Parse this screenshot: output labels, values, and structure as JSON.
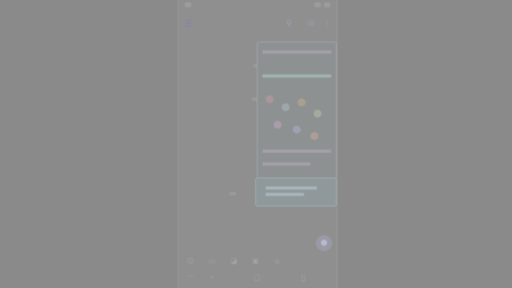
{
  "app": {
    "title": "",
    "accent": "#7f7fb0"
  },
  "header": {
    "menu_icon": "menu-icon",
    "search_icon": "search-icon",
    "call_icon": "call-icon",
    "more_icon": "more-icon"
  },
  "composer": {
    "placeholder": "",
    "send_icon": "mic-icon",
    "tools": [
      "emoji-icon",
      "gif-icon",
      "sticker-icon",
      "image-icon",
      "attach-icon",
      "more-icon"
    ]
  },
  "message_image": {
    "time": ""
  },
  "message_small": {
    "time": ""
  },
  "nav": {
    "back_icon": "back-icon",
    "home_icon": "home-icon",
    "recents_icon": "recents-icon"
  }
}
